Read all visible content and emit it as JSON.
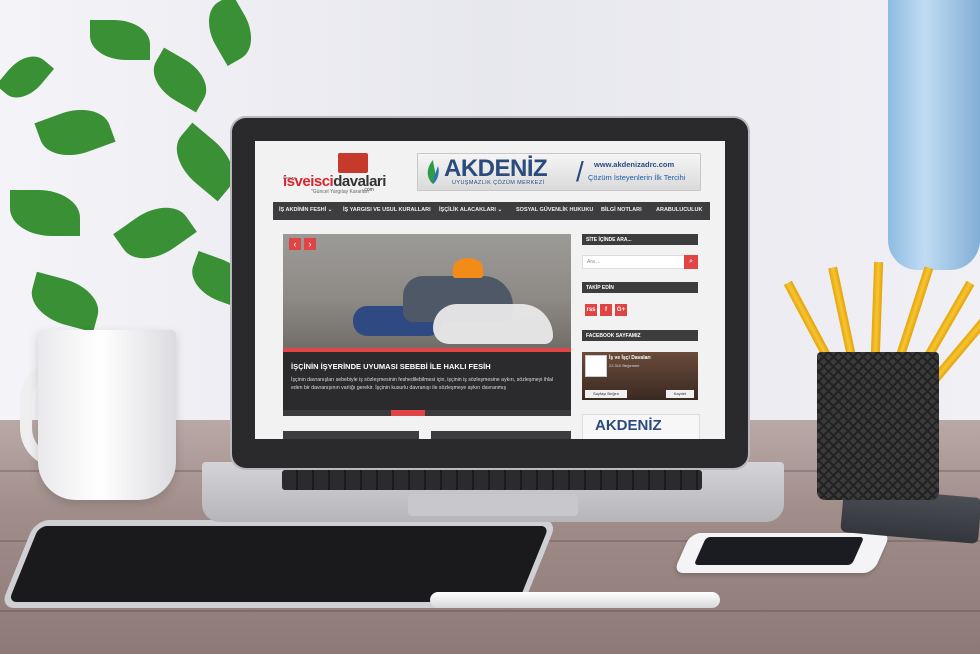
{
  "site": {
    "logo": {
      "top_text": "İşveren",
      "main_prefix": "isveisci",
      "main_suffix": "davalari",
      "com": ".com",
      "tagline": "\"Güncel Yargıtay Kararları\""
    },
    "banner": {
      "title": "AKDENİZ",
      "subtitle": "UYUŞMAZLIK ÇÖZÜM MERKEZİ",
      "url": "www.akdenizadrc.com",
      "tagline": "Çözüm İsteyenlerin İlk Tercihi"
    },
    "nav": [
      "İŞ AKDİNİN FESHİ ⌄",
      "İŞ YARGISI VE USUL KURALLARI",
      "İŞÇİLİK ALACAKLARI ⌄",
      "SOSYAL GÜVENLİK HUKUKU",
      "BİLGİ NOTLARI",
      "ARABULUCULUK"
    ],
    "slider": {
      "prev": "‹",
      "next": "›",
      "title": "İŞÇİNİN İŞYERİNDE UYUMASI SEBEBİ İLE HAKLI FESİH",
      "text": "İşçinin davranışları sebebiyle iş sözleşmesinin feshedilebilmesi için, işçinin iş sözleşmesine aykırı, sözleşmeyi ihlal eden bir davranışının varlığı gerekir. İşçinin kusurlu davranışı ile sözleşmeye aykırı davranmış"
    },
    "sidebar": {
      "search_head": "SİTE İÇİNDE ARA...",
      "search_placeholder": "Ara ...",
      "follow_head": "TAKİP EDİN",
      "social": [
        "rss",
        "f",
        "G+"
      ],
      "fb_head": "FACEBOOK SAYFAMIZ",
      "fb_name": "İş ve İşçi Davaları",
      "fb_likes": "22.310 Beğenme",
      "fb_like": "Sayfayı Beğen",
      "fb_share": "Kaydet",
      "ad_title": "AKDENİZ"
    }
  },
  "colors": {
    "accent_red": "#e04545",
    "nav_dark": "#3d3d40",
    "brand_blue": "#2c4b7d"
  }
}
